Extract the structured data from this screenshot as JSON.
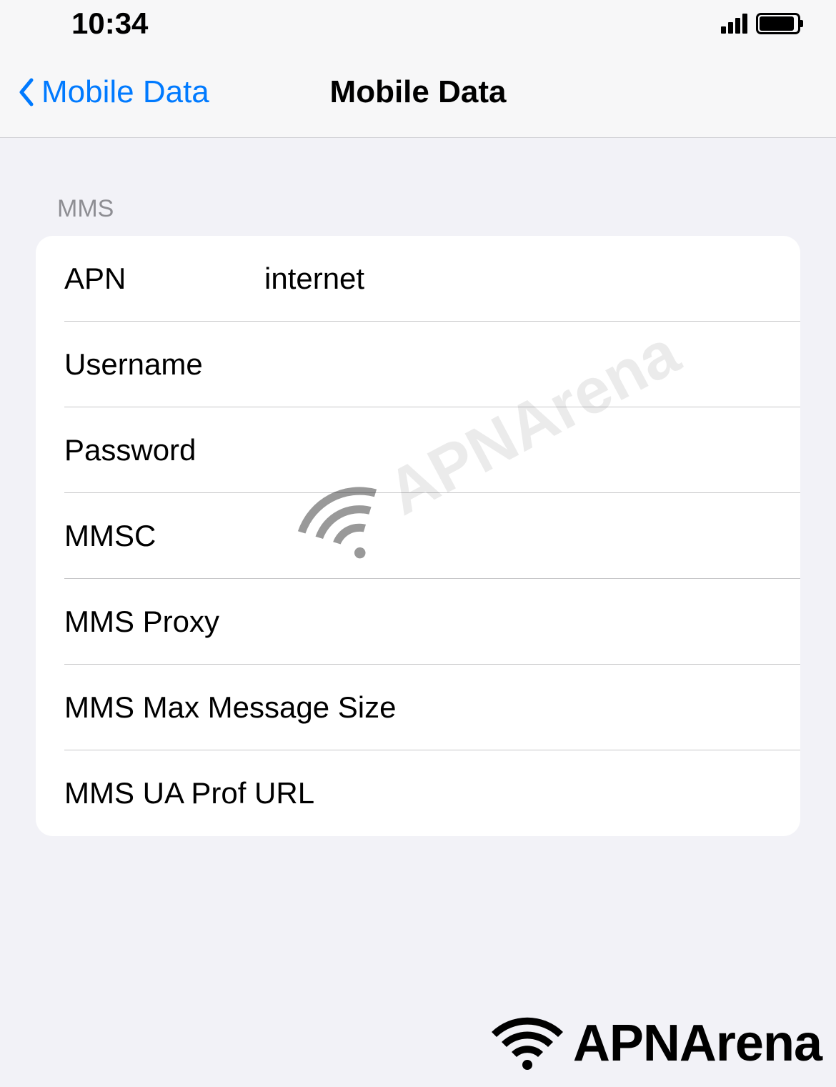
{
  "statusBar": {
    "time": "10:34"
  },
  "navBar": {
    "backLabel": "Mobile Data",
    "title": "Mobile Data"
  },
  "section": {
    "header": "MMS",
    "rows": [
      {
        "label": "APN",
        "value": "internet"
      },
      {
        "label": "Username",
        "value": ""
      },
      {
        "label": "Password",
        "value": ""
      },
      {
        "label": "MMSC",
        "value": ""
      },
      {
        "label": "MMS Proxy",
        "value": ""
      },
      {
        "label": "MMS Max Message Size",
        "value": ""
      },
      {
        "label": "MMS UA Prof URL",
        "value": ""
      }
    ]
  },
  "brand": {
    "name": "APNArena"
  }
}
